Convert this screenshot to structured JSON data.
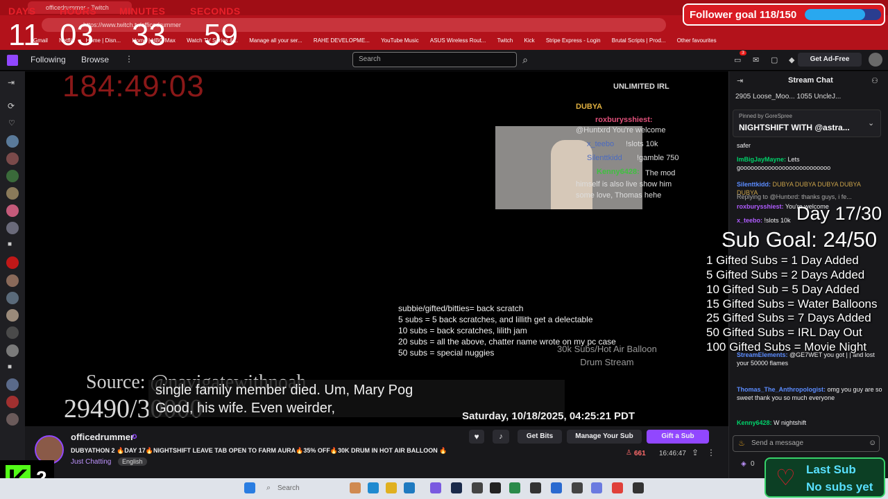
{
  "browser": {
    "tab_title": "officedrummer - Twitch",
    "url": "https://www.twitch.tv/officedrummer",
    "bookmarks": [
      "Gmail",
      "Netflix",
      "Home | Disn...",
      "Home | HBO Max",
      "Watch TV Series &...",
      "Manage all your ser...",
      "RAHE DEVELOPME...",
      "YouTube Music",
      "ASUS Wireless Rout...",
      "Twitch",
      "Kick",
      "Stripe Express - Login",
      "Brutal Scripts | Prod...",
      "Other favourites"
    ]
  },
  "countdown": {
    "labels": [
      "DAYS",
      "HOURS",
      "MINUTES",
      "SECONDS"
    ],
    "values": [
      "11",
      "03",
      "33",
      "59"
    ]
  },
  "follower_goal": {
    "text": "Follower goal 118/150",
    "current": 118,
    "target": 150
  },
  "topbar": {
    "following": "Following",
    "browse": "Browse",
    "search_placeholder": "Search",
    "ad_free": "Get Ad-Free",
    "notif_count": "3"
  },
  "video": {
    "timer": "184:49:03",
    "irl_badge": "UNLIMITED IRL",
    "overlay_chat": [
      {
        "user": "DUBYA",
        "text": ""
      },
      {
        "user": "roxburysshiest:",
        "text": "@Huntxrd You're welcome"
      },
      {
        "user": "x_teebo",
        "text": "!slots 10k"
      },
      {
        "user": "Silenttkidd",
        "text": "!gamble 750"
      },
      {
        "user": "Kenny6428:",
        "text": "The mod himself is also live show him some love, Thomas hehe"
      }
    ],
    "rules": [
      "subbie/gifted/bitties= back scratch",
      "5 subs = 5 back scratches, and lillith get a delectable",
      "10 subs = back scratches, lilith jam",
      "20 subs = all the above, chatter name wrote on my pc case",
      "50 subs = special nuggies"
    ],
    "balloon_text": [
      "30k Subs/Hot Air Balloon",
      "Drum Stream"
    ],
    "source": "Source: @navigatewithnoah",
    "sub_counter": "29490/30000",
    "captions": [
      "single family member died. Um, Mary Pog",
      "Good, his wife. Even weirder,"
    ],
    "datetime": "Saturday, 10/18/2025, 04:25:21 PDT"
  },
  "stream_info": {
    "channel": "officedrummer",
    "title": "DUBYATHON 2 🔥DAY 17🔥NIGHTSHIFT LEAVE TAB OPEN TO FARM AURA🔥35% OFF🔥30K DRUM IN HOT AIR BALLOON 🔥",
    "category": "Just Chatting",
    "language": "English",
    "get_bits": "Get Bits",
    "manage_sub": "Manage Your Sub",
    "gift_sub": "Gift a Sub",
    "viewers": "661",
    "uptime": "16:46:47"
  },
  "chat": {
    "header": "Stream Chat",
    "leaderboard": "2905 Loose_Moo... 1055 UncleJ...",
    "pinned_by": "Pinned by GoreSpree",
    "pinned_msg": "NIGHTSHIFT WITH @astra...",
    "messages": [
      {
        "user": "",
        "text": "safer",
        "color": "#efeff1"
      },
      {
        "user": "ImBigJayMayne:",
        "text": "Lets goooooooooooooooooooooooooo",
        "color": "#00d26a"
      },
      {
        "user": "Silenttkidd:",
        "text": "DUBYA DUBYA DUBYA DUBYA DUBYA",
        "color": "#5b8cff"
      },
      {
        "user": "",
        "text": "Replying to @Huntxrd: thanks guys, i fe...",
        "color": "#aaaaaa"
      },
      {
        "user": "roxburysshiest:",
        "text": "You're welcome",
        "color": "#b05cff"
      },
      {
        "user": "x_teebo:",
        "text": "!slots 10k",
        "color": "#b05cff"
      },
      {
        "user": "StreamElements:",
        "text": "@GE7WET you got | | and lost your 50000 flames",
        "color": "#5b8cff"
      },
      {
        "user": "Thomas_The_Anthropologist:",
        "text": "omg you guy are so sweet thank you so much everyone",
        "color": "#5b8cff"
      },
      {
        "user": "Kenny6428:",
        "text": "W nightshift",
        "color": "#00d26a"
      }
    ],
    "send_placeholder": "Send a message",
    "points": "0"
  },
  "sub_goal_overlay": {
    "day": "Day 17/30",
    "goal": "Sub Goal: 24/50",
    "lines": [
      "1 Gifted Subs = 1 Day Added",
      "5 Gifted Subs = 2 Days Added",
      "10 Gifted Sub = 5 Day Added",
      "15 Gifted Subs = Water Balloons",
      "25 Gifted Subs = 7 Days Added",
      "50 Gifted Subs = IRL Day Out",
      "100 Gifted Subs = Movie Night"
    ]
  },
  "kick_badge": {
    "count": "2"
  },
  "last_sub": {
    "title": "Last Sub",
    "value": "No subs yet"
  },
  "taskbar": {
    "search": "Search"
  }
}
